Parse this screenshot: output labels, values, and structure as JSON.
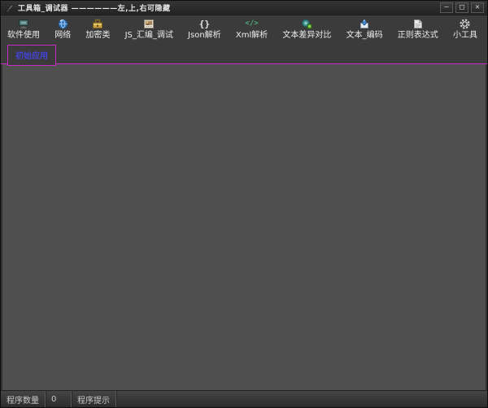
{
  "window": {
    "title": "工具箱_调试器 ——————左,上,右可隐藏",
    "controls": {
      "minimize": "–",
      "maximize": "□",
      "close": "✕"
    }
  },
  "toolbar": {
    "items": [
      {
        "label": "软件使用",
        "icon": "software-usage-icon"
      },
      {
        "label": "网络",
        "icon": "globe-icon"
      },
      {
        "label": "加密类",
        "icon": "encryption-icon"
      },
      {
        "label": "JS_汇编_调试",
        "icon": "js-asm-debug-icon"
      },
      {
        "label": "Json解析",
        "icon": "json-braces-icon",
        "glyph": "{}"
      },
      {
        "label": "Xml解析",
        "icon": "xml-code-tags-icon",
        "glyph": "</>"
      },
      {
        "label": "文本差异对比",
        "icon": "text-diff-icon"
      },
      {
        "label": "文本_编码",
        "icon": "text-encode-icon"
      },
      {
        "label": "正则表达式",
        "icon": "regex-document-icon"
      },
      {
        "label": "小工具",
        "icon": "gear-icon"
      }
    ]
  },
  "tabs": {
    "items": [
      {
        "label": "初始应用",
        "active": true
      }
    ]
  },
  "statusbar": {
    "count_label": "程序数量",
    "count_value": "0",
    "hint_label": "程序提示"
  },
  "colors": {
    "accent_magenta": "#c52cc5",
    "tab_text_blue": "#4343d6",
    "titlebar_bg": "#2c2c2c",
    "toolbar_bg": "#3b3b3b",
    "content_bg": "#4f4f4f",
    "statusbar_bg": "#383838"
  }
}
